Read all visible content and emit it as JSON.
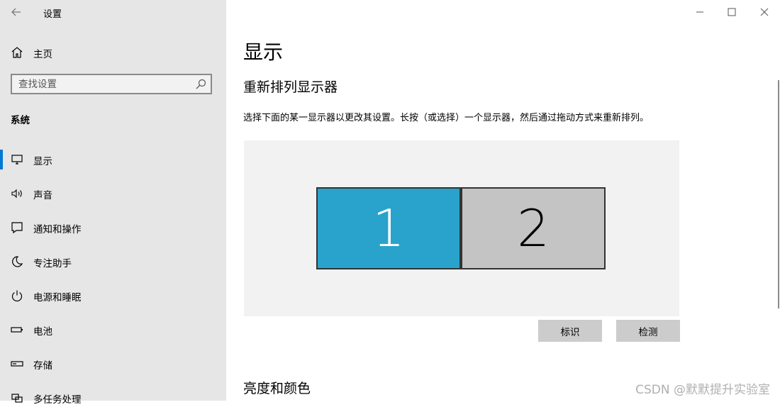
{
  "window": {
    "title": "设置",
    "controls": {
      "minimize": "minimize",
      "maximize": "maximize",
      "close": "close"
    }
  },
  "sidebar": {
    "home_label": "主页",
    "search": {
      "placeholder": "查找设置",
      "value": ""
    },
    "section_label": "系统",
    "items": [
      {
        "label": "显示",
        "icon": "monitor-icon",
        "selected": true
      },
      {
        "label": "声音",
        "icon": "speaker-icon",
        "selected": false
      },
      {
        "label": "通知和操作",
        "icon": "notification-icon",
        "selected": false
      },
      {
        "label": "专注助手",
        "icon": "moon-icon",
        "selected": false
      },
      {
        "label": "电源和睡眠",
        "icon": "power-icon",
        "selected": false
      },
      {
        "label": "电池",
        "icon": "battery-icon",
        "selected": false
      },
      {
        "label": "存储",
        "icon": "storage-icon",
        "selected": false
      },
      {
        "label": "多任务处理",
        "icon": "multitasking-icon",
        "selected": false
      }
    ]
  },
  "main": {
    "title": "显示",
    "rearrange_title": "重新排列显示器",
    "rearrange_desc": "选择下面的某一显示器以更改其设置。长按（或选择）一个显示器，然后通过拖动方式来重新排列。",
    "monitors": [
      {
        "label": "1",
        "selected": true
      },
      {
        "label": "2",
        "selected": false
      }
    ],
    "identify_label": "标识",
    "detect_label": "检测",
    "brightness_title": "亮度和颜色"
  },
  "watermark": "CSDN @默默提升实验室",
  "colors": {
    "sidebar_bg": "#e6e6e6",
    "accent": "#0078d4",
    "monitor_selected": "#2aa3cc",
    "monitor_unselected": "#c4c4c4",
    "panel_bg": "#f2f2f2",
    "button_bg": "#cccccc"
  }
}
